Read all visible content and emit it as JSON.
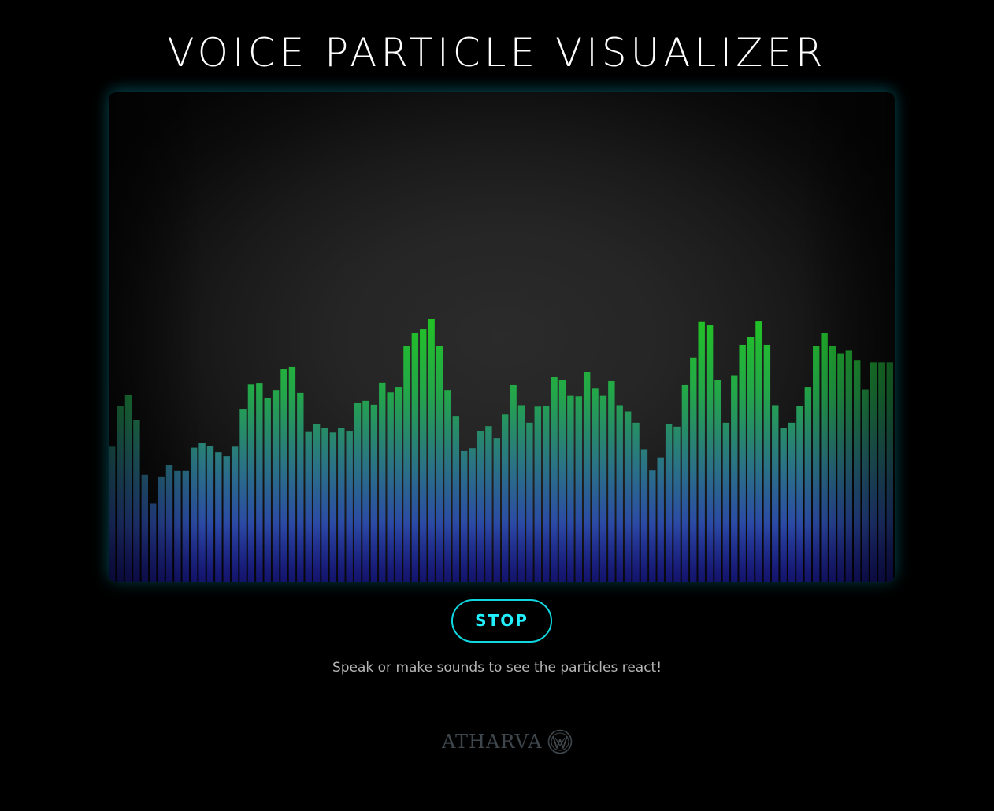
{
  "app": {
    "title": "VOICE PARTICLE VISUALIZER"
  },
  "controls": {
    "stop_label": "STOP"
  },
  "hint": {
    "text": "Speak or make sounds to see the particles react!"
  },
  "brand": {
    "name": "ATHARVA",
    "logo_icon": "atharva-logo-icon"
  },
  "colors": {
    "background": "#000000",
    "accent": "#10d6e0",
    "bar_top_high": "#25c42a",
    "bar_mid": "#2a6f8f",
    "bar_bottom": "#2322a8",
    "text_muted": "#b5b5b5",
    "brand": "#3e464c"
  },
  "visualizer": {
    "scale_max": 1.0,
    "levels": [
      0.276,
      0.36,
      0.381,
      0.33,
      0.219,
      0.16,
      0.214,
      0.238,
      0.227,
      0.227,
      0.274,
      0.283,
      0.278,
      0.265,
      0.257,
      0.276,
      0.352,
      0.403,
      0.405,
      0.376,
      0.392,
      0.434,
      0.439,
      0.386,
      0.306,
      0.323,
      0.315,
      0.305,
      0.315,
      0.307,
      0.365,
      0.37,
      0.362,
      0.407,
      0.387,
      0.397,
      0.481,
      0.508,
      0.516,
      0.537,
      0.481,
      0.392,
      0.339,
      0.267,
      0.273,
      0.308,
      0.318,
      0.294,
      0.342,
      0.402,
      0.361,
      0.325,
      0.358,
      0.36,
      0.418,
      0.413,
      0.38,
      0.379,
      0.429,
      0.395,
      0.38,
      0.41,
      0.361,
      0.348,
      0.325,
      0.271,
      0.228,
      0.253,
      0.322,
      0.317,
      0.402,
      0.457,
      0.531,
      0.524,
      0.413,
      0.325,
      0.422,
      0.484,
      0.5,
      0.532,
      0.484,
      0.361,
      0.314,
      0.325,
      0.36,
      0.397,
      0.482,
      0.508,
      0.481,
      0.467,
      0.472,
      0.453,
      0.393,
      0.448,
      0.448,
      0.448
    ]
  }
}
